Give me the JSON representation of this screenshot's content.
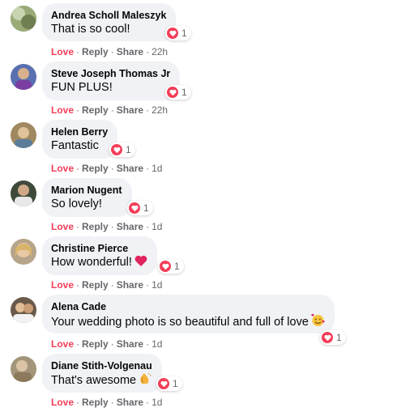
{
  "comments": [
    {
      "author": "Andrea Scholl Maleszyk",
      "text": "That is so cool!",
      "reactions": "1",
      "time": "22h"
    },
    {
      "author": "Steve Joseph Thomas Jr",
      "text": "FUN PLUS!",
      "reactions": "1",
      "time": "22h"
    },
    {
      "author": "Helen Berry",
      "text": "Fantastic",
      "reactions": "1",
      "time": "1d"
    },
    {
      "author": "Marion Nugent",
      "text": "So lovely!",
      "reactions": "1",
      "time": "1d"
    },
    {
      "author": "Christine Pierce",
      "text": "How wonderful!",
      "reactions": "1",
      "time": "1d"
    },
    {
      "author": "Alena Cade",
      "text": "Your wedding photo is so beautiful and full of love",
      "reactions": "1",
      "time": "1d"
    },
    {
      "author": "Diane Stith-Volgenau",
      "text": "That's awesome",
      "reactions": "1",
      "time": "1d"
    }
  ],
  "actions": {
    "love": "Love",
    "reply": "Reply",
    "share": "Share",
    "separator": "·"
  },
  "colors": {
    "love": "#f33e58",
    "bubble": "#f0f2f5",
    "meta": "#65676b"
  },
  "icons": {
    "reaction": "heart-icon",
    "emoji_4": "red-heart-emoji",
    "emoji_5": "smiling-face-with-hearts-emoji",
    "emoji_6": "clapping-hands-emoji"
  }
}
